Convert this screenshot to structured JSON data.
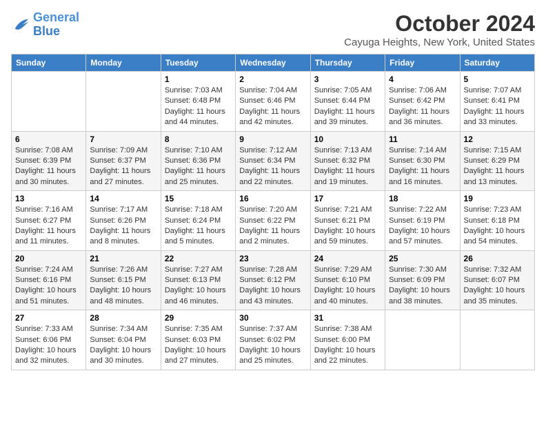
{
  "header": {
    "logo_general": "General",
    "logo_blue": "Blue",
    "month": "October 2024",
    "location": "Cayuga Heights, New York, United States"
  },
  "weekdays": [
    "Sunday",
    "Monday",
    "Tuesday",
    "Wednesday",
    "Thursday",
    "Friday",
    "Saturday"
  ],
  "weeks": [
    [
      {
        "day": "",
        "info": ""
      },
      {
        "day": "",
        "info": ""
      },
      {
        "day": "1",
        "info": "Sunrise: 7:03 AM\nSunset: 6:48 PM\nDaylight: 11 hours and 44 minutes."
      },
      {
        "day": "2",
        "info": "Sunrise: 7:04 AM\nSunset: 6:46 PM\nDaylight: 11 hours and 42 minutes."
      },
      {
        "day": "3",
        "info": "Sunrise: 7:05 AM\nSunset: 6:44 PM\nDaylight: 11 hours and 39 minutes."
      },
      {
        "day": "4",
        "info": "Sunrise: 7:06 AM\nSunset: 6:42 PM\nDaylight: 11 hours and 36 minutes."
      },
      {
        "day": "5",
        "info": "Sunrise: 7:07 AM\nSunset: 6:41 PM\nDaylight: 11 hours and 33 minutes."
      }
    ],
    [
      {
        "day": "6",
        "info": "Sunrise: 7:08 AM\nSunset: 6:39 PM\nDaylight: 11 hours and 30 minutes."
      },
      {
        "day": "7",
        "info": "Sunrise: 7:09 AM\nSunset: 6:37 PM\nDaylight: 11 hours and 27 minutes."
      },
      {
        "day": "8",
        "info": "Sunrise: 7:10 AM\nSunset: 6:36 PM\nDaylight: 11 hours and 25 minutes."
      },
      {
        "day": "9",
        "info": "Sunrise: 7:12 AM\nSunset: 6:34 PM\nDaylight: 11 hours and 22 minutes."
      },
      {
        "day": "10",
        "info": "Sunrise: 7:13 AM\nSunset: 6:32 PM\nDaylight: 11 hours and 19 minutes."
      },
      {
        "day": "11",
        "info": "Sunrise: 7:14 AM\nSunset: 6:30 PM\nDaylight: 11 hours and 16 minutes."
      },
      {
        "day": "12",
        "info": "Sunrise: 7:15 AM\nSunset: 6:29 PM\nDaylight: 11 hours and 13 minutes."
      }
    ],
    [
      {
        "day": "13",
        "info": "Sunrise: 7:16 AM\nSunset: 6:27 PM\nDaylight: 11 hours and 11 minutes."
      },
      {
        "day": "14",
        "info": "Sunrise: 7:17 AM\nSunset: 6:26 PM\nDaylight: 11 hours and 8 minutes."
      },
      {
        "day": "15",
        "info": "Sunrise: 7:18 AM\nSunset: 6:24 PM\nDaylight: 11 hours and 5 minutes."
      },
      {
        "day": "16",
        "info": "Sunrise: 7:20 AM\nSunset: 6:22 PM\nDaylight: 11 hours and 2 minutes."
      },
      {
        "day": "17",
        "info": "Sunrise: 7:21 AM\nSunset: 6:21 PM\nDaylight: 10 hours and 59 minutes."
      },
      {
        "day": "18",
        "info": "Sunrise: 7:22 AM\nSunset: 6:19 PM\nDaylight: 10 hours and 57 minutes."
      },
      {
        "day": "19",
        "info": "Sunrise: 7:23 AM\nSunset: 6:18 PM\nDaylight: 10 hours and 54 minutes."
      }
    ],
    [
      {
        "day": "20",
        "info": "Sunrise: 7:24 AM\nSunset: 6:16 PM\nDaylight: 10 hours and 51 minutes."
      },
      {
        "day": "21",
        "info": "Sunrise: 7:26 AM\nSunset: 6:15 PM\nDaylight: 10 hours and 48 minutes."
      },
      {
        "day": "22",
        "info": "Sunrise: 7:27 AM\nSunset: 6:13 PM\nDaylight: 10 hours and 46 minutes."
      },
      {
        "day": "23",
        "info": "Sunrise: 7:28 AM\nSunset: 6:12 PM\nDaylight: 10 hours and 43 minutes."
      },
      {
        "day": "24",
        "info": "Sunrise: 7:29 AM\nSunset: 6:10 PM\nDaylight: 10 hours and 40 minutes."
      },
      {
        "day": "25",
        "info": "Sunrise: 7:30 AM\nSunset: 6:09 PM\nDaylight: 10 hours and 38 minutes."
      },
      {
        "day": "26",
        "info": "Sunrise: 7:32 AM\nSunset: 6:07 PM\nDaylight: 10 hours and 35 minutes."
      }
    ],
    [
      {
        "day": "27",
        "info": "Sunrise: 7:33 AM\nSunset: 6:06 PM\nDaylight: 10 hours and 32 minutes."
      },
      {
        "day": "28",
        "info": "Sunrise: 7:34 AM\nSunset: 6:04 PM\nDaylight: 10 hours and 30 minutes."
      },
      {
        "day": "29",
        "info": "Sunrise: 7:35 AM\nSunset: 6:03 PM\nDaylight: 10 hours and 27 minutes."
      },
      {
        "day": "30",
        "info": "Sunrise: 7:37 AM\nSunset: 6:02 PM\nDaylight: 10 hours and 25 minutes."
      },
      {
        "day": "31",
        "info": "Sunrise: 7:38 AM\nSunset: 6:00 PM\nDaylight: 10 hours and 22 minutes."
      },
      {
        "day": "",
        "info": ""
      },
      {
        "day": "",
        "info": ""
      }
    ]
  ]
}
